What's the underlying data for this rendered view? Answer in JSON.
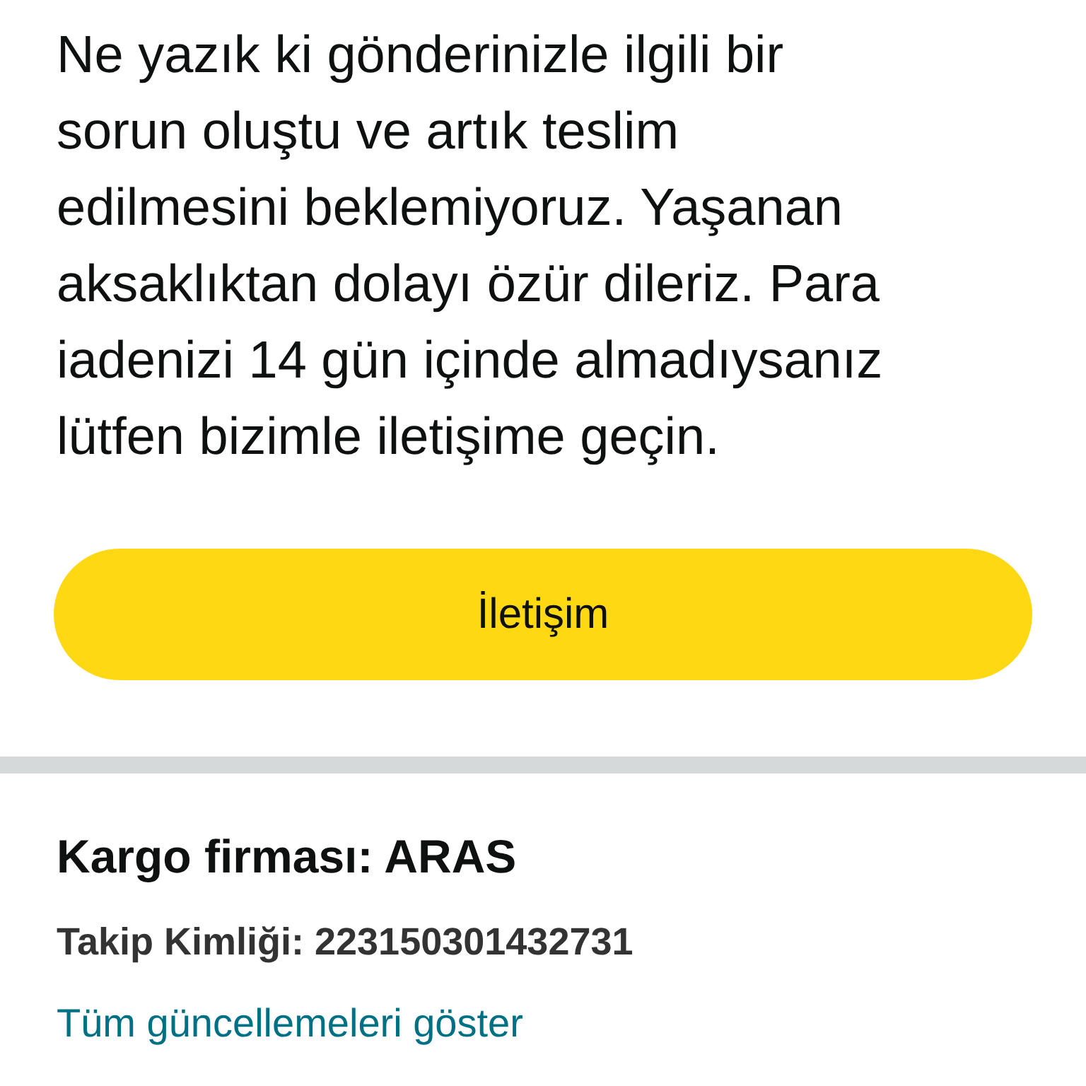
{
  "message": "Ne yazık ki gönderinizle ilgili bir sorun oluştu ve artık teslim edilmesini beklemiyoruz. Yaşanan aksaklıktan dolayı özür dileriz. Para iadenizi 14 gün içinde almadıysanız lütfen bizimle iletişime geçin.",
  "contact_button": "İletişim",
  "carrier": "Kargo firması: ARAS",
  "tracking_id": "Takip Kimliği: 223150301432731",
  "updates_link": "Tüm güncellemeleri göster"
}
